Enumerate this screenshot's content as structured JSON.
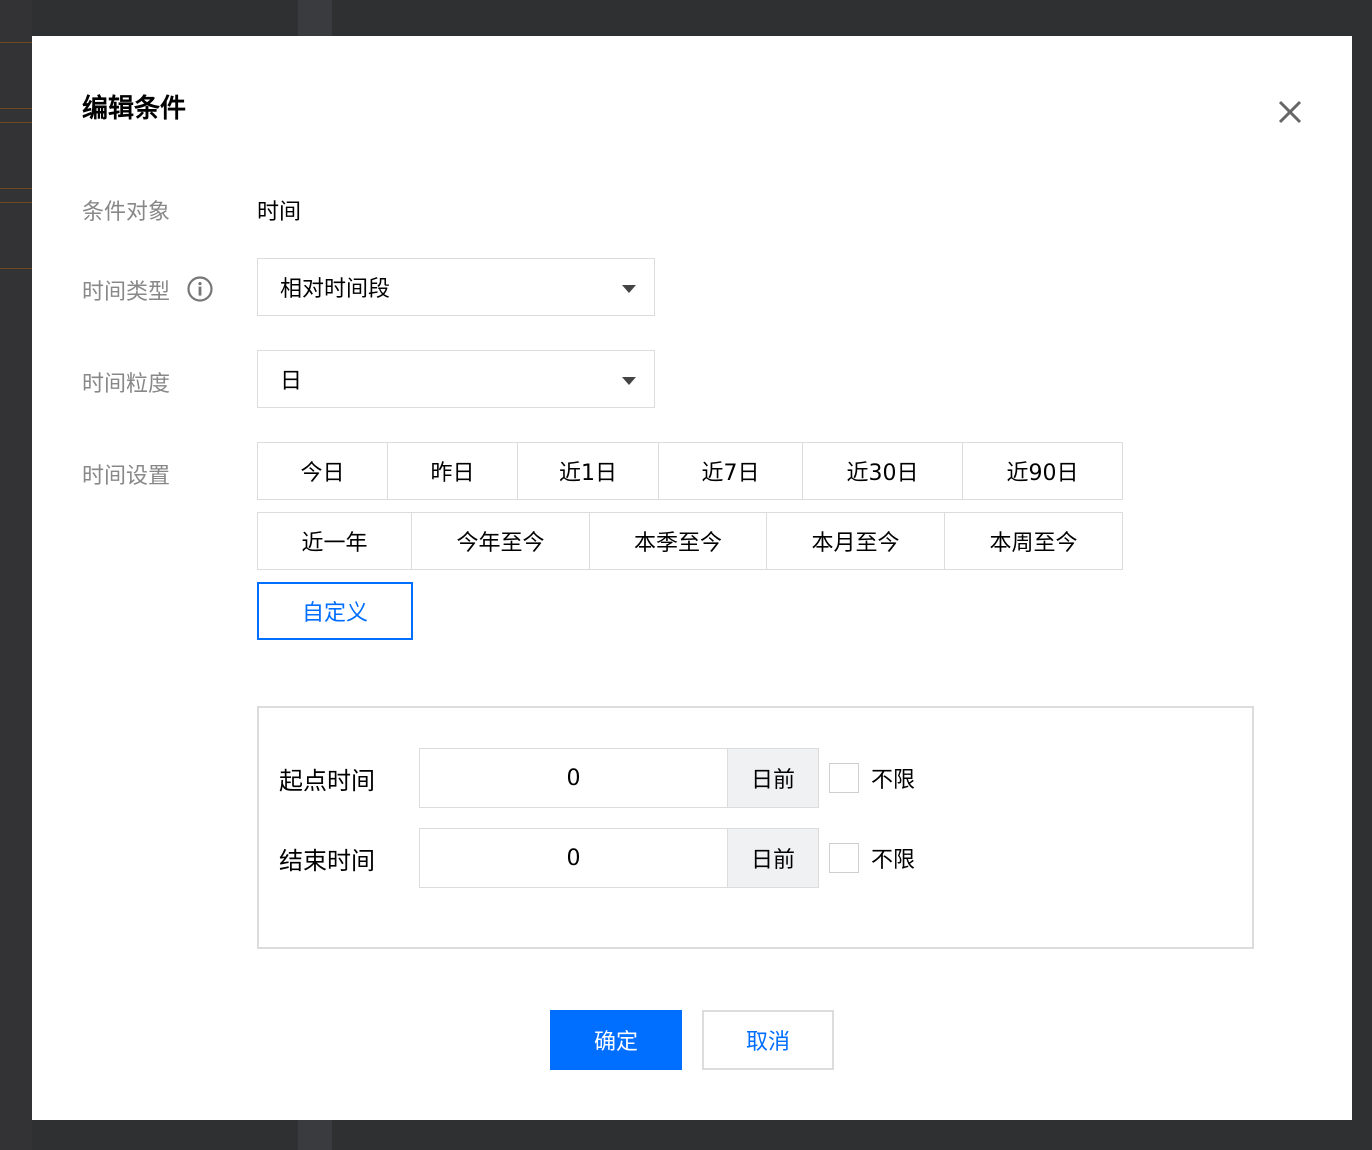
{
  "dialog": {
    "title": "编辑条件"
  },
  "form": {
    "condition_object": {
      "label": "条件对象",
      "value": "时间"
    },
    "time_type": {
      "label": "时间类型",
      "selected": "相对时间段"
    },
    "granularity": {
      "label": "时间粒度",
      "selected": "日"
    },
    "time_setting": {
      "label": "时间设置",
      "row1": [
        "今日",
        "昨日",
        "近1日",
        "近7日",
        "近30日",
        "近90日"
      ],
      "row2": [
        "近一年",
        "今年至今",
        "本季至今",
        "本月至今",
        "本周至今"
      ],
      "row3": [
        "自定义"
      ],
      "active": "自定义"
    }
  },
  "range": {
    "start": {
      "label": "起点时间",
      "value": "0",
      "unit": "日前",
      "unlimited_label": "不限",
      "unlimited_checked": false
    },
    "end": {
      "label": "结束时间",
      "value": "0",
      "unit": "日前",
      "unlimited_label": "不限",
      "unlimited_checked": false
    }
  },
  "footer": {
    "confirm_label": "确定",
    "cancel_label": "取消"
  },
  "colors": {
    "accent": "#006eff",
    "overlay": "#2f3032"
  }
}
